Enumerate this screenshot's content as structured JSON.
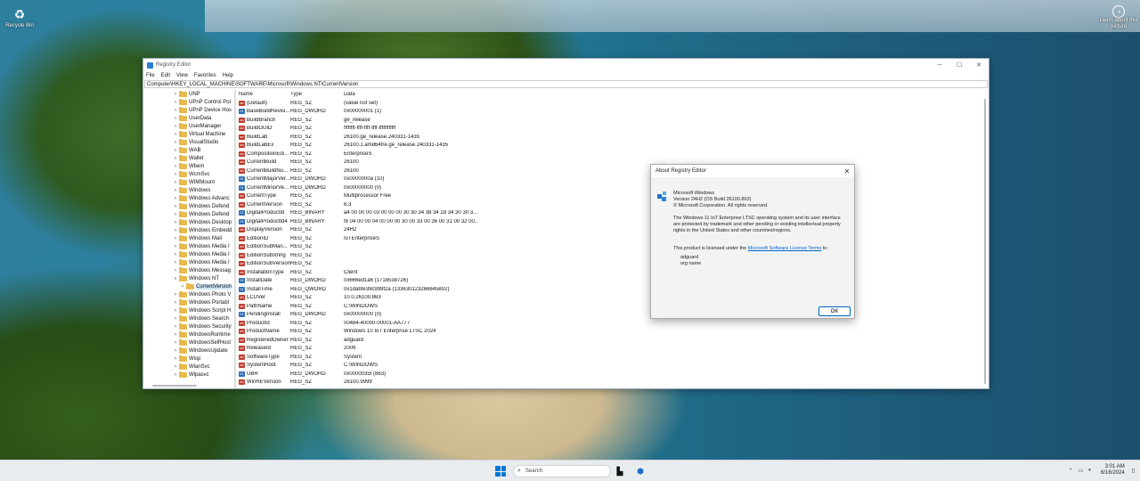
{
  "desktop": {
    "recycle_bin": "Recycle Bin",
    "learn_about": "Learn about this picture"
  },
  "regedit": {
    "title": "Registry Editor",
    "menu": [
      "File",
      "Edit",
      "View",
      "Favorites",
      "Help"
    ],
    "address": "Computer\\HKEY_LOCAL_MACHINE\\SOFTWARE\\Microsoft\\Windows NT\\CurrentVersion",
    "tree": [
      {
        "label": "UNP",
        "exp": ">"
      },
      {
        "label": "UPnP Control Poi",
        "exp": ">"
      },
      {
        "label": "UPnP Device Hos",
        "exp": ">"
      },
      {
        "label": "UserData",
        "exp": ">"
      },
      {
        "label": "UserManager",
        "exp": ">"
      },
      {
        "label": "Virtual Machine",
        "exp": ">"
      },
      {
        "label": "VisualStudio",
        "exp": ">"
      },
      {
        "label": "WAB",
        "exp": ">"
      },
      {
        "label": "Wallet",
        "exp": ">"
      },
      {
        "label": "Wbem",
        "exp": ">"
      },
      {
        "label": "WcmSvc",
        "exp": ">"
      },
      {
        "label": "WIMMount",
        "exp": ">"
      },
      {
        "label": "Windows",
        "exp": ">"
      },
      {
        "label": "Windows Advanc",
        "exp": ">"
      },
      {
        "label": "Windows Defend",
        "exp": ">"
      },
      {
        "label": "Windows Defend",
        "exp": ">"
      },
      {
        "label": "Windows Desktop",
        "exp": ">"
      },
      {
        "label": "Windows Embedd",
        "exp": ">"
      },
      {
        "label": "Windows Mail",
        "exp": ">"
      },
      {
        "label": "Windows Media I",
        "exp": ">"
      },
      {
        "label": "Windows Media I",
        "exp": ">"
      },
      {
        "label": "Windows Media I",
        "exp": ">"
      },
      {
        "label": "Windows Messag",
        "exp": ">"
      },
      {
        "label": "Windows NT",
        "exp": "v"
      },
      {
        "label": "CurrentVersion",
        "exp": ">",
        "child": true,
        "selected": true
      },
      {
        "label": "Windows Photo V",
        "exp": ">"
      },
      {
        "label": "Windows Portabl",
        "exp": ">"
      },
      {
        "label": "Windows Script H",
        "exp": ">"
      },
      {
        "label": "Windows Search",
        "exp": ">"
      },
      {
        "label": "Windows Security",
        "exp": ">"
      },
      {
        "label": "WindowsRuntime",
        "exp": ">"
      },
      {
        "label": "WindowsSelfHost",
        "exp": ">"
      },
      {
        "label": "WindowsUpdate",
        "exp": ">"
      },
      {
        "label": "Wisp",
        "exp": ">"
      },
      {
        "label": "WlanSvc",
        "exp": ">"
      },
      {
        "label": "Wlpasvc",
        "exp": ">"
      }
    ],
    "columns": {
      "name": "Name",
      "type": "Type",
      "data": "Data"
    },
    "values": [
      {
        "name": "(Default)",
        "type": "REG_SZ",
        "data": "(value not set)",
        "icon": "sz"
      },
      {
        "name": "BaseBuildRevisi...",
        "type": "REG_DWORD",
        "data": "0x00000001 (1)",
        "icon": "bin"
      },
      {
        "name": "BuildBranch",
        "type": "REG_SZ",
        "data": "ge_release",
        "icon": "sz"
      },
      {
        "name": "BuildGUID",
        "type": "REG_SZ",
        "data": "ffffffff-ffff-ffff-ffff-ffffffffffff",
        "icon": "sz"
      },
      {
        "name": "BuildLab",
        "type": "REG_SZ",
        "data": "26100.ge_release.240331-1435",
        "icon": "sz"
      },
      {
        "name": "BuildLabEx",
        "type": "REG_SZ",
        "data": "26100.1.amd64fre.ge_release.240331-1435",
        "icon": "sz"
      },
      {
        "name": "CompositionEdi...",
        "type": "REG_SZ",
        "data": "EnterpriseS",
        "icon": "sz"
      },
      {
        "name": "CurrentBuild",
        "type": "REG_SZ",
        "data": "26100",
        "icon": "sz"
      },
      {
        "name": "CurrentBuildNu...",
        "type": "REG_SZ",
        "data": "26100",
        "icon": "sz"
      },
      {
        "name": "CurrentMajorVer...",
        "type": "REG_DWORD",
        "data": "0x0000000a (10)",
        "icon": "bin"
      },
      {
        "name": "CurrentMinorVe...",
        "type": "REG_DWORD",
        "data": "0x00000000 (0)",
        "icon": "bin"
      },
      {
        "name": "CurrentType",
        "type": "REG_SZ",
        "data": "Multiprocessor Free",
        "icon": "sz"
      },
      {
        "name": "CurrentVersion",
        "type": "REG_SZ",
        "data": "6.3",
        "icon": "sz"
      },
      {
        "name": "DigitalProductId",
        "type": "REG_BINARY",
        "data": "a4 00 00 00 03 00 00 00 30 30 34 38 34 2d 34 30 30 3...",
        "icon": "bin"
      },
      {
        "name": "DigitalProductId4",
        "type": "REG_BINARY",
        "data": "f8 04 00 00 04 00 00 00 30 00 33 00 36 00 31 00 32 00...",
        "icon": "bin"
      },
      {
        "name": "DisplayVersion",
        "type": "REG_SZ",
        "data": "24H2",
        "icon": "sz"
      },
      {
        "name": "EditionID",
        "type": "REG_SZ",
        "data": "IoTEnterpriseS",
        "icon": "sz"
      },
      {
        "name": "EditionSubMan...",
        "type": "REG_SZ",
        "data": "",
        "icon": "sz"
      },
      {
        "name": "EditionSubstring",
        "type": "REG_SZ",
        "data": "",
        "icon": "sz"
      },
      {
        "name": "EditionSubVersion",
        "type": "REG_SZ",
        "data": "",
        "icon": "sz"
      },
      {
        "name": "InstallationType",
        "type": "REG_SZ",
        "data": "Client",
        "icon": "sz"
      },
      {
        "name": "InstallDate",
        "type": "REG_DWORD",
        "data": "0x666ed1a6 (1718538726)",
        "icon": "bin"
      },
      {
        "name": "InstallTime",
        "type": "REG_QWORD",
        "data": "0x1dabfe39c999f2a (133630123266645802)",
        "icon": "bin"
      },
      {
        "name": "LCUVer",
        "type": "REG_SZ",
        "data": "10.0.26100.863",
        "icon": "sz"
      },
      {
        "name": "PathName",
        "type": "REG_SZ",
        "data": "C:\\WINDOWS",
        "icon": "sz"
      },
      {
        "name": "PendingInstall",
        "type": "REG_DWORD",
        "data": "0x00000000 (0)",
        "icon": "bin"
      },
      {
        "name": "ProductId",
        "type": "REG_SZ",
        "data": "00484-40000-00001-AA777",
        "icon": "sz"
      },
      {
        "name": "ProductName",
        "type": "REG_SZ",
        "data": "Windows 10 IoT Enterprise LTSC 2024",
        "icon": "sz"
      },
      {
        "name": "RegisteredOwner",
        "type": "REG_SZ",
        "data": "adguard",
        "icon": "sz"
      },
      {
        "name": "ReleaseId",
        "type": "REG_SZ",
        "data": "2009",
        "icon": "sz"
      },
      {
        "name": "SoftwareType",
        "type": "REG_SZ",
        "data": "System",
        "icon": "sz"
      },
      {
        "name": "SystemRoot",
        "type": "REG_SZ",
        "data": "C:\\WINDOWS",
        "icon": "sz"
      },
      {
        "name": "UBR",
        "type": "REG_DWORD",
        "data": "0x0000035f (863)",
        "icon": "bin"
      },
      {
        "name": "WinREVersion",
        "type": "REG_SZ",
        "data": "26100.9999",
        "icon": "sz"
      }
    ]
  },
  "about": {
    "title": "About Registry Editor",
    "product": "Microsoft Windows",
    "version": "Version 24H2 (OS Build 26100.863)",
    "copyright": "© Microsoft Corporation. All rights reserved.",
    "legal": "The Windows 11 IoT Enterprise LTSC operating system and its user interface are protected by trademark and other pending or existing intellectual property rights in the United States and other countries/regions.",
    "license_prefix": "This product is licensed under the",
    "license_link": "Microsoft Software License Terms",
    "license_suffix": "to:",
    "user": "adguard",
    "org": "org name",
    "ok": "OK"
  },
  "taskbar": {
    "search_placeholder": "Search",
    "time": "3:01 AM",
    "date": "6/16/2024"
  }
}
